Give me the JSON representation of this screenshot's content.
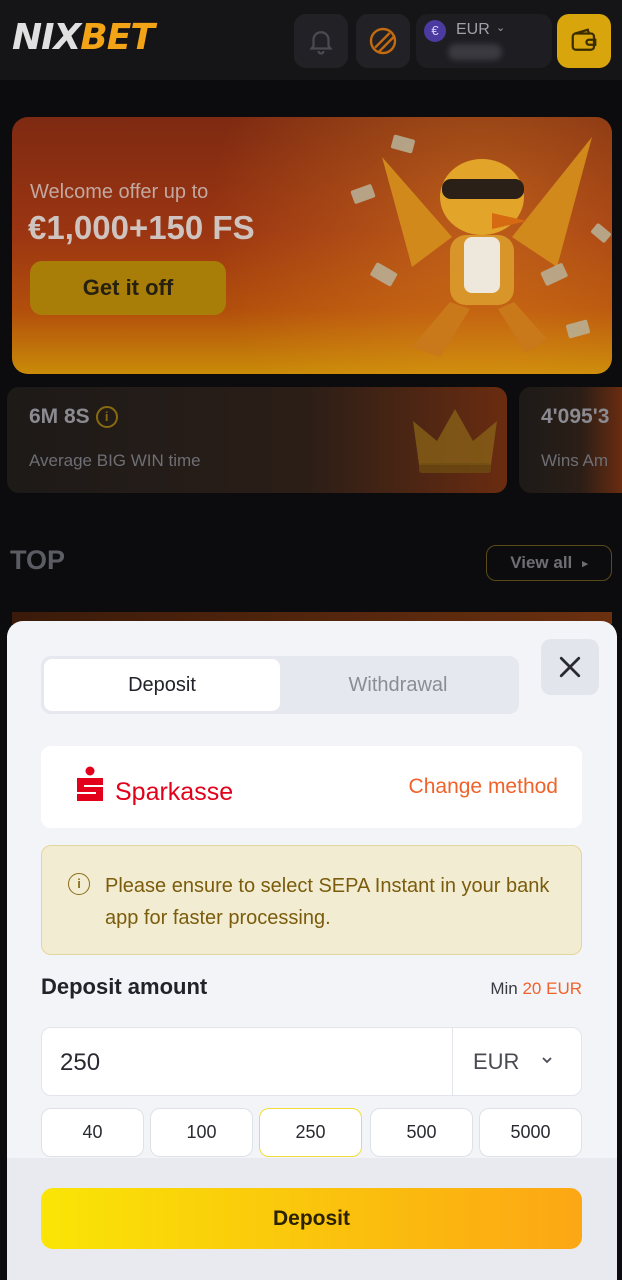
{
  "header": {
    "logo_left": "NIX",
    "logo_right": "BET",
    "currency": "EUR",
    "currency_symbol": "€"
  },
  "banner": {
    "subtitle": "Welcome offer up to",
    "title": "€1,000+150 FS",
    "button": "Get it off"
  },
  "stats": [
    {
      "value": "6M 8S",
      "label": "Average BIG WIN time"
    },
    {
      "value": "4'095'3",
      "label": "Wins Am"
    }
  ],
  "top": {
    "title": "TOP",
    "view_all": "View all"
  },
  "modal": {
    "tabs": [
      "Deposit",
      "Withdrawal"
    ],
    "active_tab": "Deposit",
    "method": {
      "name": "Sparkasse",
      "change": "Change method"
    },
    "notice": "Please ensure to select SEPA Instant in your bank app for faster processing.",
    "amount_label": "Deposit amount",
    "min_label": "Min",
    "min_value": "20 EUR",
    "amount_value": "250",
    "currency": "EUR",
    "quick_amounts": [
      "40",
      "100",
      "250",
      "500",
      "5000"
    ],
    "selected_amount": "250",
    "submit": "Deposit"
  },
  "colors": {
    "accent_yellow": "#fae506",
    "accent_orange": "#f0622a",
    "sparkasse_red": "#e2001a"
  }
}
